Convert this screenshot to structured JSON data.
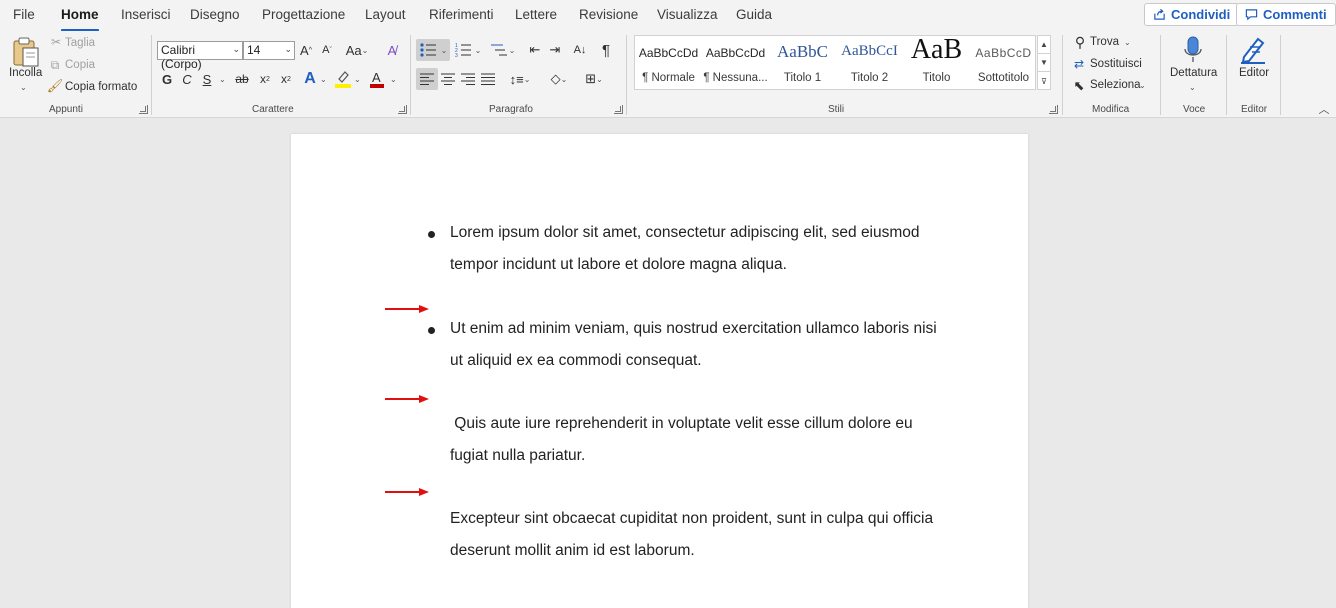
{
  "tabs": [
    "File",
    "Home",
    "Inserisci",
    "Disegno",
    "Progettazione",
    "Layout",
    "Riferimenti",
    "Lettere",
    "Revisione",
    "Visualizza",
    "Guida"
  ],
  "active_tab": "Home",
  "top_buttons": {
    "share": "Condividi",
    "comments": "Commenti"
  },
  "clipboard": {
    "paste": "Incolla",
    "cut": "Taglia",
    "copy": "Copia",
    "format_painter": "Copia formato",
    "label": "Appunti"
  },
  "font": {
    "name": "Calibri (Corpo)",
    "size": "14",
    "label": "Carattere",
    "bold": "G",
    "italic": "C",
    "underline": "S",
    "strikethrough": "ab",
    "change_case": "Aa"
  },
  "paragraph": {
    "label": "Paragrafo"
  },
  "styles": {
    "label": "Stili",
    "items": [
      {
        "preview": "AaBbCcDd",
        "name": "¶ Normale"
      },
      {
        "preview": "AaBbCcDd",
        "name": "¶ Nessuna..."
      },
      {
        "preview": "AaBbC",
        "name": "Titolo 1"
      },
      {
        "preview": "AaBbCcI",
        "name": "Titolo 2"
      },
      {
        "preview": "AaB",
        "name": "Titolo"
      },
      {
        "preview": "AaBbCcD",
        "name": "Sottotitolo"
      }
    ]
  },
  "editing": {
    "find": "Trova",
    "replace": "Sostituisci",
    "select": "Seleziona",
    "label": "Modifica"
  },
  "voice": {
    "dictate": "Dettatura",
    "label": "Voce"
  },
  "editor": {
    "button": "Editor",
    "label": "Editor"
  },
  "document": {
    "lines": [
      "Lorem ipsum dolor sit amet, consectetur adipiscing elit, sed eiusmod",
      "tempor incidunt ut labore et dolore magna aliqua.",
      "Ut enim ad minim veniam, quis nostrud exercitation ullamco laboris nisi",
      "ut aliquid ex ea commodi consequat.",
      " Quis aute iure reprehenderit in voluptate velit esse cillum dolore eu",
      "fugiat nulla pariatur.",
      "Excepteur sint obcaecat cupiditat non proident, sunt in culpa qui officia",
      "deserunt mollit anim id est laborum."
    ]
  },
  "colors": {
    "accent": "#1f5fbf",
    "arrow": "#e01010",
    "highlight": "#ffef00",
    "font_color": "#c00000"
  }
}
